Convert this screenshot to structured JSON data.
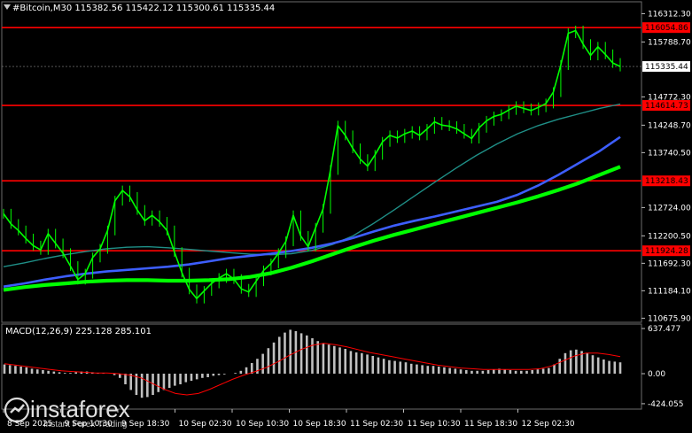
{
  "header": {
    "symbol_line": "#Bitcoin,M30  115382.56 115422.12 115300.61 115335.44"
  },
  "macd_header": "MACD(12,26,9) 225.128 285.101",
  "logo": {
    "brand": "instaforex",
    "tagline": "Instant Forex Trading"
  },
  "colors": {
    "background": "#000000",
    "price": "#00ff00",
    "ma_slow": "#00ff00",
    "ma_mid": "#3d5eff",
    "ma_fast": "#1f8f87",
    "level": "#ff0000",
    "macd_hist": "#c0c0c0",
    "macd_signal": "#ff0000"
  },
  "chart_data": [
    {
      "type": "line",
      "panel": "price",
      "ylim": [
        110600,
        116500
      ],
      "y_ticks": [
        116312.3,
        115788.7,
        114772.3,
        114248.7,
        113740.5,
        112724.0,
        112200.5,
        111692.3,
        111184.1,
        110675.9
      ],
      "y_tick_labels": [
        "116312.30",
        "115788.70",
        "114772.30",
        "114248.70",
        "113740.50",
        "112724.00",
        "112200.50",
        "111692.30",
        "111184.10",
        "110675.90"
      ],
      "x_labels": [
        "8 Sep 2025",
        "9 Sep 10:30",
        "9 Sep 18:30",
        "10 Sep 02:30",
        "10 Sep 10:30",
        "10 Sep 18:30",
        "11 Sep 02:30",
        "11 Sep 10:30",
        "11 Sep 18:30",
        "12 Sep 02:30"
      ],
      "current_price": 115335.44,
      "current_price_label": "115335.44",
      "levels": [
        {
          "value": 116054.86,
          "label": "116054.86"
        },
        {
          "value": 114614.73,
          "label": "114614.73"
        },
        {
          "value": 113218.43,
          "label": "113218.43"
        },
        {
          "value": 111924.28,
          "label": "111924.28"
        }
      ],
      "series": [
        {
          "values": [
            112610,
            112420,
            112300,
            112150,
            112020,
            111940,
            112240,
            112060,
            111880,
            111640,
            111390,
            111500,
            111800,
            111960,
            112300,
            112850,
            113040,
            112920,
            112680,
            112480,
            112580,
            112460,
            112300,
            111900,
            111520,
            111210,
            111040,
            111180,
            111320,
            111420,
            111500,
            111400,
            111220,
            111160,
            111360,
            111560,
            111690,
            111880,
            112100,
            112580,
            112200,
            112000,
            112350,
            112700,
            113420,
            114240,
            114060,
            113820,
            113620,
            113490,
            113700,
            113940,
            114060,
            114010,
            114090,
            114140,
            114060,
            114180,
            114310,
            114250,
            114230,
            114180,
            114090,
            114000,
            114200,
            114330,
            114410,
            114450,
            114530,
            114600,
            114560,
            114520,
            114580,
            114650,
            114860,
            115360,
            115950,
            116000,
            115750,
            115540,
            115700,
            115560,
            115400,
            115335
          ]
        },
        {
          "name": "",
          "values": [
            111630,
            111700,
            111780,
            111850,
            111910,
            111960,
            111990,
            112000,
            111980,
            111950,
            111920,
            111890,
            111860,
            111850,
            111870,
            111930,
            112040,
            112200,
            112430,
            112680,
            112940,
            113200,
            113450,
            113690,
            113900,
            114090,
            114240,
            114360,
            114460,
            114560,
            114640
          ]
        },
        {
          "name": "",
          "values": [
            111260,
            111320,
            111390,
            111450,
            111500,
            111540,
            111570,
            111600,
            111630,
            111670,
            111730,
            111790,
            111830,
            111870,
            111920,
            111980,
            112060,
            112160,
            112280,
            112390,
            112480,
            112560,
            112650,
            112740,
            112830,
            112960,
            113130,
            113330,
            113550,
            113770,
            114030
          ]
        },
        {
          "name": "",
          "values": [
            111200,
            111250,
            111290,
            111320,
            111350,
            111370,
            111380,
            111380,
            111370,
            111370,
            111380,
            111400,
            111440,
            111510,
            111610,
            111730,
            111860,
            111990,
            112110,
            112220,
            112320,
            112420,
            112520,
            112620,
            112720,
            112820,
            112930,
            113050,
            113180,
            113330,
            113480
          ]
        }
      ]
    },
    {
      "type": "bar",
      "panel": "MACD(12,26,9)",
      "ylim": [
        -500,
        700
      ],
      "y_ticks": [
        637.477,
        0.0,
        -424.055
      ],
      "y_tick_labels": [
        "637.477",
        "0.00",
        "-424.055"
      ],
      "series": [
        {
          "name": "MACD",
          "values": [
            130,
            120,
            110,
            100,
            90,
            70,
            60,
            50,
            40,
            30,
            20,
            10,
            10,
            20,
            30,
            30,
            20,
            10,
            5,
            0,
            -20,
            -60,
            -150,
            -230,
            -300,
            -340,
            -330,
            -300,
            -260,
            -230,
            -200,
            -170,
            -150,
            -120,
            -100,
            -80,
            -60,
            -50,
            -30,
            -20,
            -10,
            0,
            10,
            40,
            90,
            150,
            210,
            280,
            360,
            440,
            520,
            580,
            620,
            600,
            570,
            540,
            500,
            460,
            430,
            410,
            390,
            370,
            350,
            320,
            300,
            290,
            270,
            250,
            230,
            210,
            190,
            180,
            170,
            160,
            140,
            130,
            120,
            110,
            110,
            100,
            90,
            80,
            70,
            60,
            50,
            40,
            40,
            40,
            50,
            60,
            70,
            60,
            50,
            40,
            40,
            40,
            50,
            60,
            70,
            80,
            130,
            210,
            290,
            330,
            340,
            320,
            290,
            260,
            230,
            200,
            180,
            170,
            160
          ]
        },
        {
          "name": "Signal",
          "values": [
            140,
            120,
            100,
            80,
            60,
            40,
            30,
            20,
            10,
            10,
            0,
            -20,
            -60,
            -140,
            -220,
            -280,
            -300,
            -280,
            -220,
            -150,
            -80,
            -20,
            30,
            90,
            170,
            260,
            340,
            400,
            430,
            410,
            380,
            340,
            300,
            270,
            240,
            210,
            180,
            150,
            120,
            100,
            80,
            70,
            60,
            60,
            60,
            60,
            60,
            70,
            110,
            180,
            250,
            290,
            290,
            270,
            240
          ]
        }
      ]
    }
  ]
}
